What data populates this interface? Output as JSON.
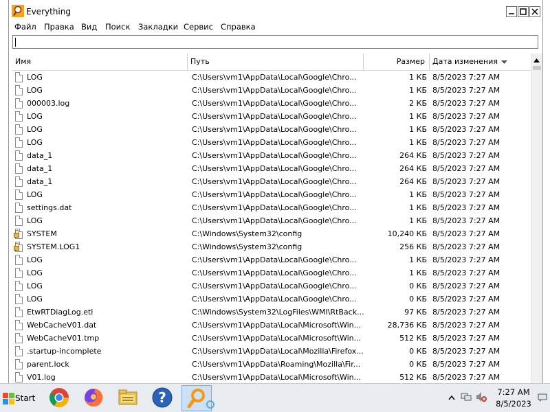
{
  "window": {
    "title": "Everything"
  },
  "menu": [
    "Файл",
    "Правка",
    "Вид",
    "Поиск",
    "Закладки",
    "Сервис",
    "Справка"
  ],
  "search": {
    "value": ""
  },
  "columns": {
    "name": "Имя",
    "path": "Путь",
    "size": "Размер",
    "date": "Дата изменения"
  },
  "rows": [
    {
      "name": "LOG",
      "path": "C:\\Users\\vm1\\AppData\\Local\\Google\\Chro...",
      "size": "1 КБ",
      "date": "8/5/2023 7:27 AM",
      "icon": "file-icon"
    },
    {
      "name": "LOG",
      "path": "C:\\Users\\vm1\\AppData\\Local\\Google\\Chro...",
      "size": "1 КБ",
      "date": "8/5/2023 7:27 AM",
      "icon": "file-icon"
    },
    {
      "name": "000003.log",
      "path": "C:\\Users\\vm1\\AppData\\Local\\Google\\Chro...",
      "size": "2 КБ",
      "date": "8/5/2023 7:27 AM",
      "icon": "file-icon"
    },
    {
      "name": "LOG",
      "path": "C:\\Users\\vm1\\AppData\\Local\\Google\\Chro...",
      "size": "1 КБ",
      "date": "8/5/2023 7:27 AM",
      "icon": "file-icon"
    },
    {
      "name": "LOG",
      "path": "C:\\Users\\vm1\\AppData\\Local\\Google\\Chro...",
      "size": "1 КБ",
      "date": "8/5/2023 7:27 AM",
      "icon": "file-icon"
    },
    {
      "name": "LOG",
      "path": "C:\\Users\\vm1\\AppData\\Local\\Google\\Chro...",
      "size": "1 КБ",
      "date": "8/5/2023 7:27 AM",
      "icon": "file-icon"
    },
    {
      "name": "data_1",
      "path": "C:\\Users\\vm1\\AppData\\Local\\Google\\Chro...",
      "size": "264 КБ",
      "date": "8/5/2023 7:27 AM",
      "icon": "file-icon"
    },
    {
      "name": "data_1",
      "path": "C:\\Users\\vm1\\AppData\\Local\\Google\\Chro...",
      "size": "264 КБ",
      "date": "8/5/2023 7:27 AM",
      "icon": "file-icon"
    },
    {
      "name": "data_1",
      "path": "C:\\Users\\vm1\\AppData\\Local\\Google\\Chro...",
      "size": "264 КБ",
      "date": "8/5/2023 7:27 AM",
      "icon": "file-icon"
    },
    {
      "name": "LOG",
      "path": "C:\\Users\\vm1\\AppData\\Local\\Google\\Chro...",
      "size": "1 КБ",
      "date": "8/5/2023 7:27 AM",
      "icon": "file-icon"
    },
    {
      "name": "settings.dat",
      "path": "C:\\Users\\vm1\\AppData\\Local\\Google\\Chro...",
      "size": "1 КБ",
      "date": "8/5/2023 7:27 AM",
      "icon": "file-icon"
    },
    {
      "name": "LOG",
      "path": "C:\\Users\\vm1\\AppData\\Local\\Google\\Chro...",
      "size": "1 КБ",
      "date": "8/5/2023 7:27 AM",
      "icon": "file-icon"
    },
    {
      "name": "SYSTEM",
      "path": "C:\\Windows\\System32\\config",
      "size": "10,240 КБ",
      "date": "8/5/2023 7:27 AM",
      "icon": "locked-file-icon"
    },
    {
      "name": "SYSTEM.LOG1",
      "path": "C:\\Windows\\System32\\config",
      "size": "256 КБ",
      "date": "8/5/2023 7:27 AM",
      "icon": "locked-file-icon"
    },
    {
      "name": "LOG",
      "path": "C:\\Users\\vm1\\AppData\\Local\\Google\\Chro...",
      "size": "1 КБ",
      "date": "8/5/2023 7:27 AM",
      "icon": "file-icon"
    },
    {
      "name": "LOG",
      "path": "C:\\Users\\vm1\\AppData\\Local\\Google\\Chro...",
      "size": "1 КБ",
      "date": "8/5/2023 7:27 AM",
      "icon": "file-icon"
    },
    {
      "name": "LOG",
      "path": "C:\\Users\\vm1\\AppData\\Local\\Google\\Chro...",
      "size": "0 КБ",
      "date": "8/5/2023 7:27 AM",
      "icon": "file-icon"
    },
    {
      "name": "LOG",
      "path": "C:\\Users\\vm1\\AppData\\Local\\Google\\Chro...",
      "size": "0 КБ",
      "date": "8/5/2023 7:27 AM",
      "icon": "file-icon"
    },
    {
      "name": "EtwRTDiagLog.etl",
      "path": "C:\\Windows\\System32\\LogFiles\\WMI\\RtBack...",
      "size": "97 КБ",
      "date": "8/5/2023 7:27 AM",
      "icon": "file-icon"
    },
    {
      "name": "WebCacheV01.dat",
      "path": "C:\\Users\\vm1\\AppData\\Local\\Microsoft\\Win...",
      "size": "28,736 КБ",
      "date": "8/5/2023 7:27 AM",
      "icon": "file-icon"
    },
    {
      "name": "WebCacheV01.tmp",
      "path": "C:\\Users\\vm1\\AppData\\Local\\Microsoft\\Win...",
      "size": "512 КБ",
      "date": "8/5/2023 7:27 AM",
      "icon": "file-icon"
    },
    {
      "name": ".startup-incomplete",
      "path": "C:\\Users\\vm1\\AppData\\Local\\Mozilla\\Firefox...",
      "size": "0 КБ",
      "date": "8/5/2023 7:27 AM",
      "icon": "file-icon"
    },
    {
      "name": "parent.lock",
      "path": "C:\\Users\\vm1\\AppData\\Roaming\\Mozilla\\Fir...",
      "size": "0 КБ",
      "date": "8/5/2023 7:27 AM",
      "icon": "file-icon"
    },
    {
      "name": "V01.log",
      "path": "C:\\Users\\vm1\\AppData\\Local\\Microsoft\\Win...",
      "size": "512 КБ",
      "date": "8/5/2023 7:27 AM",
      "icon": "file-icon"
    }
  ],
  "taskbar": {
    "start_label": "Start",
    "apps": [
      "chrome-icon",
      "firefox-icon",
      "file-explorer-icon",
      "help-icon",
      "everything-search-icon"
    ],
    "clock_time": "7:27 AM",
    "clock_date": "8/5/2023"
  }
}
